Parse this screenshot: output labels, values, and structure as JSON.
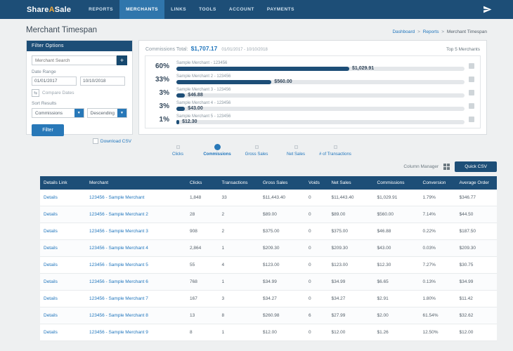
{
  "colors": {
    "navy": "#1d4e77",
    "accent_blue": "#2878b8",
    "link_blue": "#2176bd",
    "active_nav": "#3076ac"
  },
  "nav": {
    "brand": {
      "prefix": "Share",
      "accent": "A",
      "suffix": "Sale"
    },
    "items": [
      {
        "label": "REPORTS",
        "active": false
      },
      {
        "label": "MERCHANTS",
        "active": true
      },
      {
        "label": "LINKS",
        "active": false
      },
      {
        "label": "TOOLS",
        "active": false
      },
      {
        "label": "ACCOUNT",
        "active": false
      },
      {
        "label": "PAYMENTS",
        "active": false
      }
    ]
  },
  "page": {
    "title": "Merchant Timespan",
    "breadcrumb": [
      "Dashboard",
      "Reports",
      "Merchant Timespan"
    ],
    "crumb_separator": ">"
  },
  "filter": {
    "header": "Filter Options",
    "merchant_search_placeholder": "Merchant Search",
    "add_button": "+",
    "date_range_label": "Date Range",
    "date_from": "01/01/2017",
    "date_to": "10/10/2018",
    "compare_dates_label": "Compare Dates",
    "sort_results_label": "Sort Results",
    "sort_field": "Commissions",
    "sort_direction": "Descending",
    "filter_button": "Filter",
    "download_csv_label": "Download CSV"
  },
  "chart_header": {
    "label": "Commissions Total:",
    "total": "$1,707.17",
    "date_range": "01/01/2017 - 10/10/2018",
    "top_label": "Top 5 Merchants"
  },
  "chart_data": {
    "type": "bar",
    "orientation": "horizontal",
    "title": "Top 5 Merchants",
    "metric": "Commissions",
    "total": 1707.17,
    "categories": [
      "Sample Merchant - 123456",
      "Sample Merchant 2 - 123456",
      "Sample Merchant 3 - 123456",
      "Sample Merchant 4 - 123456",
      "Sample Merchant 5 - 123456"
    ],
    "percents": [
      60,
      33,
      3,
      3,
      1
    ],
    "percent_labels": [
      "60%",
      "33%",
      "3%",
      "3%",
      "1%"
    ],
    "values": [
      1029.91,
      560.0,
      46.88,
      43.0,
      12.3
    ],
    "value_labels": [
      "$1,029.91",
      "$560.00",
      "$46.88",
      "$43.00",
      "$12.30"
    ],
    "xlim": [
      0,
      100
    ]
  },
  "carousel": {
    "items": [
      {
        "label": "Clicks",
        "active": false
      },
      {
        "label": "Commissions",
        "active": true
      },
      {
        "label": "Gross Sales",
        "active": false
      },
      {
        "label": "Net Sales",
        "active": false
      },
      {
        "label": "# of Transactions",
        "active": false
      }
    ]
  },
  "table_tools": {
    "column_manager": "Column Manager",
    "quick_csv": "Quick CSV"
  },
  "table": {
    "columns": [
      "Details Link",
      "Merchant",
      "Clicks",
      "Transactions",
      "Gross Sales",
      "Voids",
      "Net Sales",
      "Commissions",
      "Conversion",
      "Average Order"
    ],
    "rows": [
      {
        "details": "Details",
        "merchant": "123456 - Sample Merchant",
        "clicks": "1,848",
        "transactions": "33",
        "gross": "$11,443.40",
        "voids": "0",
        "net": "$11,443.40",
        "commissions": "$1,029.91",
        "conversion": "1.79%",
        "avg": "$346.77"
      },
      {
        "details": "Details",
        "merchant": "123456 - Sample Merchant 2",
        "clicks": "28",
        "transactions": "2",
        "gross": "$89.00",
        "voids": "0",
        "net": "$89.00",
        "commissions": "$560.00",
        "conversion": "7.14%",
        "avg": "$44.50"
      },
      {
        "details": "Details",
        "merchant": "123456 - Sample Merchant 3",
        "clicks": "908",
        "transactions": "2",
        "gross": "$375.00",
        "voids": "0",
        "net": "$375.00",
        "commissions": "$46.88",
        "conversion": "0.22%",
        "avg": "$187.50"
      },
      {
        "details": "Details",
        "merchant": "123456 - Sample Merchant 4",
        "clicks": "2,864",
        "transactions": "1",
        "gross": "$209.30",
        "voids": "0",
        "net": "$209.30",
        "commissions": "$43.00",
        "conversion": "0.03%",
        "avg": "$209.30"
      },
      {
        "details": "Details",
        "merchant": "123456 - Sample Merchant 5",
        "clicks": "55",
        "transactions": "4",
        "gross": "$123.00",
        "voids": "0",
        "net": "$123.00",
        "commissions": "$12.30",
        "conversion": "7.27%",
        "avg": "$30.75"
      },
      {
        "details": "Details",
        "merchant": "123456 - Sample Merchant 6",
        "clicks": "768",
        "transactions": "1",
        "gross": "$34.99",
        "voids": "0",
        "net": "$34.99",
        "commissions": "$6.65",
        "conversion": "0.13%",
        "avg": "$34.99"
      },
      {
        "details": "Details",
        "merchant": "123456 - Sample Merchant 7",
        "clicks": "167",
        "transactions": "3",
        "gross": "$34.27",
        "voids": "0",
        "net": "$34.27",
        "commissions": "$2.91",
        "conversion": "1.80%",
        "avg": "$11.42"
      },
      {
        "details": "Details",
        "merchant": "123456 - Sample Merchant 8",
        "clicks": "13",
        "transactions": "8",
        "gross": "$260.98",
        "voids": "6",
        "net": "$27.99",
        "commissions": "$2.00",
        "conversion": "61.54%",
        "avg": "$32.62"
      },
      {
        "details": "Details",
        "merchant": "123456 - Sample Merchant 9",
        "clicks": "8",
        "transactions": "1",
        "gross": "$12.00",
        "voids": "0",
        "net": "$12.00",
        "commissions": "$1.26",
        "conversion": "12.50%",
        "avg": "$12.00"
      }
    ]
  }
}
